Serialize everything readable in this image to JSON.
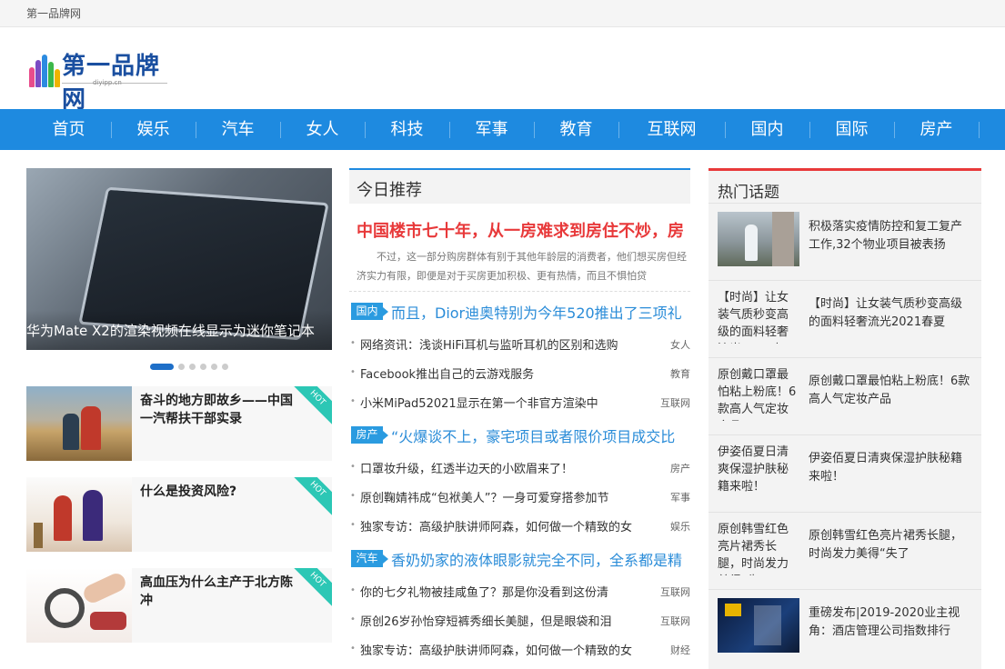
{
  "topbar": {
    "site_name": "第一品牌网"
  },
  "logo": {
    "brand": "第一品牌网",
    "domain": "diyipp.cn"
  },
  "nav": [
    "首页",
    "娱乐",
    "汽车",
    "女人",
    "科技",
    "军事",
    "教育",
    "互联网",
    "国内",
    "国际",
    "房产"
  ],
  "slider": {
    "caption": "华为Mate X2的渲染视频在线显示为迷你笔记本",
    "dot_count": 6,
    "active_dot": 0
  },
  "features": [
    {
      "title": "奋斗的地方即故乡——中国一汽帮扶干部实录",
      "badge": "HOT"
    },
    {
      "title": "什么是投资风险?",
      "badge": "HOT"
    },
    {
      "title": "高血压为什么主产于北方陈冲",
      "badge": "HOT"
    }
  ],
  "middle": {
    "heading": "今日推荐",
    "headline": "中国楼市七十年，从一房难求到房住不炒，房",
    "summary": "不过，这一部分购房群体有别于其他年龄层的消费者，他们想买房但经济实力有限，即便是对于买房更加积极、更有热情，而且不惧怕贷",
    "sections": [
      {
        "tag": "国内",
        "title": "而且，Dior迪奥特别为今年520推出了三项礼",
        "items": [
          {
            "text": "网络资讯：浅谈HiFi耳机与监听耳机的区别和选购",
            "cat": "女人"
          },
          {
            "text": "Facebook推出自己的云游戏服务",
            "cat": "教育"
          },
          {
            "text": "小米MiPad52021显示在第一个非官方渲染中",
            "cat": "互联网"
          }
        ]
      },
      {
        "tag": "房产",
        "title": "“火爆谈不上，豪宅项目或者限价项目成交比",
        "items": [
          {
            "text": "口罩妆升级，红透半边天的小欧眉来了！",
            "cat": "房产"
          },
          {
            "text": "原创鞠婧祎成“包袱美人”？一身可爱穿搭参加节",
            "cat": "军事"
          },
          {
            "text": "独家专访：高级护肤讲师阿森，如何做一个精致的女",
            "cat": "娱乐"
          }
        ]
      },
      {
        "tag": "汽车",
        "title": "香奶奶家的液体眼影就完全不同，全系都是精",
        "items": [
          {
            "text": "你的七夕礼物被挂咸鱼了？那是你没看到这份清",
            "cat": "互联网"
          },
          {
            "text": "原创26岁孙怡穿短裤秀细长美腿，但是眼袋和泪",
            "cat": "互联网"
          },
          {
            "text": "独家专访：高级护肤讲师阿森，如何做一个精致的女",
            "cat": "财经"
          }
        ]
      }
    ]
  },
  "right": {
    "heading": "热门话题",
    "items": [
      {
        "alt": "",
        "text": "积极落实疫情防控和复工复产工作,32个物业项目被表扬"
      },
      {
        "alt": "【时尚】让女装气质秒变高级的面料轻奢流光2021春",
        "text": "【时尚】让女装气质秒变高级的面料轻奢流光2021春夏"
      },
      {
        "alt": "原创戴口罩最怕粘上粉底！6款高人气定妆产品",
        "text": "原创戴口罩最怕粘上粉底！6款高人气定妆产品"
      },
      {
        "alt": "伊姿佰夏日清爽保湿护肤秘籍来啦！",
        "text": "伊姿佰夏日清爽保湿护肤秘籍来啦！"
      },
      {
        "alt": "原创韩雪红色亮片裙秀长腿，时尚发力美得“失了",
        "text": "原创韩雪红色亮片裙秀长腿，时尚发力美得“失了"
      },
      {
        "alt": "",
        "text": "重磅发布|2019-2020业主视角：酒店管理公司指数排行"
      }
    ]
  },
  "colors": {
    "nav_blue": "#1e8ae0",
    "headline_red": "#e8393a",
    "tag_blue": "#2a9be0",
    "hot_teal": "#2cc7b5"
  }
}
